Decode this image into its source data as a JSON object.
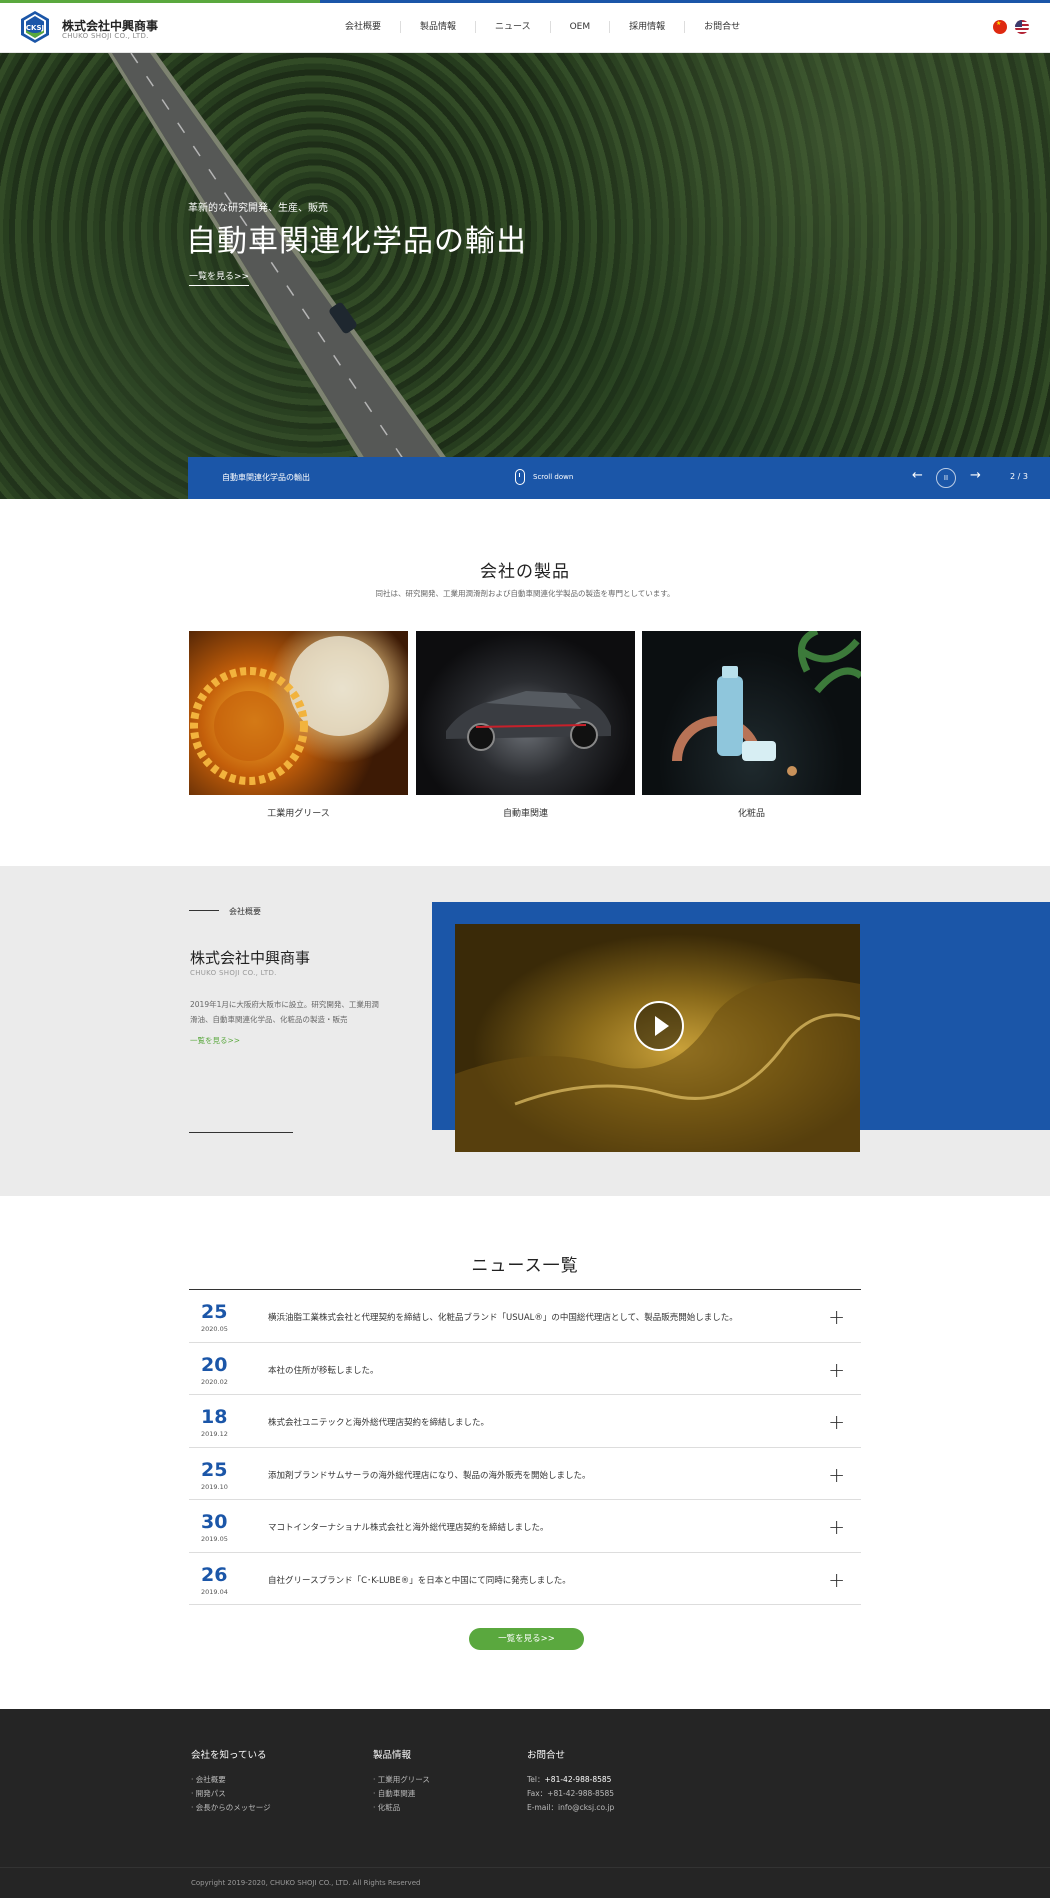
{
  "header": {
    "brand_jp": "株式会社中興商事",
    "brand_en": "CHUKO SHOJI CO., LTD.",
    "logo_text": "CKSJ",
    "nav": [
      "会社概要",
      "製品情報",
      "ニュース",
      "OEM",
      "採用情報",
      "お問合せ"
    ]
  },
  "hero": {
    "subtitle": "革新的な研究開発、生産、販売",
    "title": "自動車関連化学品の輸出",
    "more": "一覧を見る>>",
    "caption": "自動車関連化学品の輸出",
    "scroll_text": "Scroll down",
    "prev": "←",
    "next": "→",
    "pause": "II",
    "counter": "2 / 3"
  },
  "products": {
    "title": "会社の製品",
    "desc": "同社は、研究開発、工業用潤滑剤および自動車関連化学製品の製造を専門としています。",
    "items": [
      {
        "name": "工業用グリース"
      },
      {
        "name": "自動車関連"
      },
      {
        "name": "化粧品"
      }
    ]
  },
  "about": {
    "label": "会社概要",
    "title": "株式会社中興商事",
    "en": "CHUKO SHOJI CO., LTD.",
    "text": "2019年1月に大阪府大阪市に設立。研究開発、工業用潤滑油、自動車関連化学品、化粧品の製造・販売",
    "more": "一覧を見る>>"
  },
  "news": {
    "title": "ニュース一覧",
    "items": [
      {
        "day": "25",
        "ym": "2020.05",
        "text": "横浜油脂工業株式会社と代理契約を締結し、化粧品ブランド「USUAL®」の中国総代理店として、製品販売開始しました。"
      },
      {
        "day": "20",
        "ym": "2020.02",
        "text": "本社の住所が移転しました。"
      },
      {
        "day": "18",
        "ym": "2019.12",
        "text": "株式会社ユニテックと海外総代理店契約を締結しました。"
      },
      {
        "day": "25",
        "ym": "2019.10",
        "text": "添加剤ブランドサムサーラの海外総代理店になり、製品の海外販売を開始しました。"
      },
      {
        "day": "30",
        "ym": "2019.05",
        "text": "マコトインターナショナル株式会社と海外総代理店契約を締結しました。"
      },
      {
        "day": "26",
        "ym": "2019.04",
        "text": "自社グリースブランド「C･K-LUBE®」を日本と中国にて同時に発売しました。"
      }
    ],
    "plus": "+",
    "more": "一覧を見る>>"
  },
  "footer": {
    "col1": {
      "head": "会社を知っている",
      "items": [
        "会社概要",
        "開発パス",
        "会長からのメッセージ"
      ]
    },
    "col2": {
      "head": "製品情報",
      "items": [
        "工業用グリース",
        "自動車関連",
        "化粧品"
      ]
    },
    "col3": {
      "head": "お問合せ",
      "tel_label": "Tel：",
      "tel": "+81-42-988-8585",
      "fax": "Fax：+81-42-988-8585",
      "email": "E-mail：info@cksj.co.jp"
    },
    "copyright": "Copyright 2019-2020, CHUKO SHOJI CO., LTD.  All Rights Reserved"
  },
  "colors": {
    "brand_blue": "#1b56a8",
    "accent_green": "#5aa83e",
    "footer_bg": "#252525"
  }
}
